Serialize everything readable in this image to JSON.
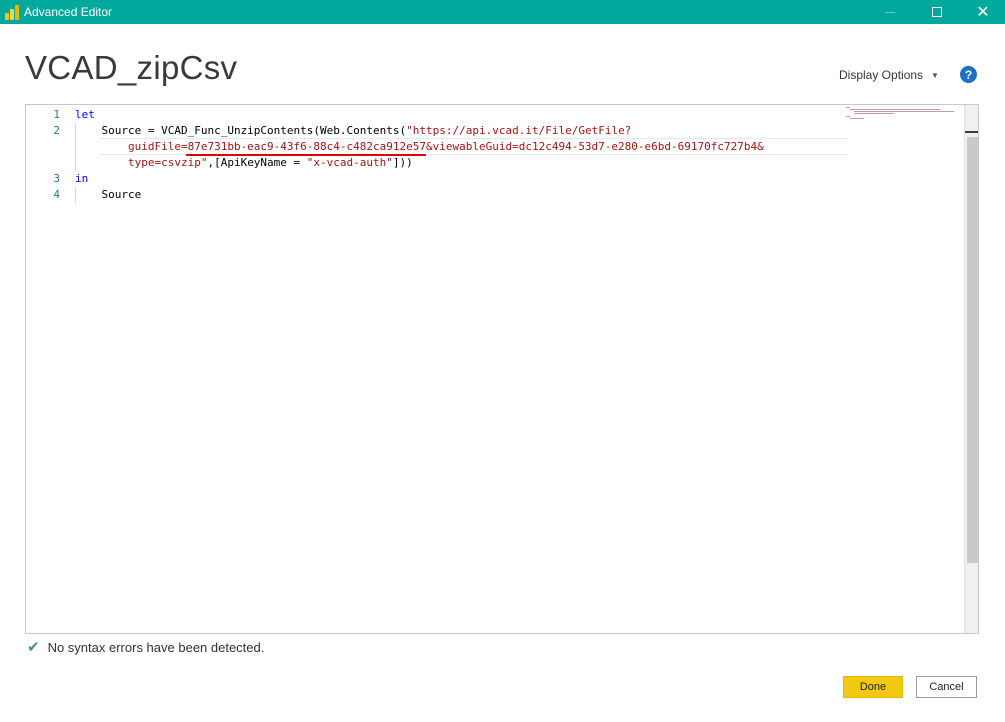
{
  "window": {
    "title": "Advanced Editor",
    "icon": "powerbi-icon",
    "colors": {
      "titlebar": "#01a99d",
      "accent_button": "#f2c811"
    }
  },
  "header": {
    "query_name": "VCAD_zipCsv",
    "display_options_label": "Display Options",
    "help_label": "?"
  },
  "editor": {
    "lines": [
      {
        "number": "1",
        "tokens": [
          {
            "t": "let",
            "c": "kw"
          }
        ]
      },
      {
        "number": "2",
        "tokens": [
          {
            "t": "    Source = VCAD_Func_UnzipContents(Web.Contents(",
            "c": ""
          },
          {
            "t": "\"https://api.vcad.it/File/GetFile?",
            "c": "str"
          }
        ]
      },
      {
        "number": "",
        "tokens": [
          {
            "t": "        guidFile=87e731bb-eac9-43f6-88c4-c482ca912e57&viewableGuid=dc12c494-53d7-e280-e6bd-69170fc727b4&",
            "c": "str"
          }
        ]
      },
      {
        "number": "",
        "tokens": [
          {
            "t": "        type=csvzip\"",
            "c": "str"
          },
          {
            "t": ",[ApiKeyName = ",
            "c": ""
          },
          {
            "t": "\"x-vcad-auth\"",
            "c": "str"
          },
          {
            "t": "]))",
            "c": ""
          }
        ]
      },
      {
        "number": "3",
        "tokens": [
          {
            "t": "in",
            "c": "kw"
          }
        ]
      },
      {
        "number": "4",
        "tokens": [
          {
            "t": "    Source",
            "c": ""
          }
        ]
      }
    ]
  },
  "status": {
    "icon": "check-icon",
    "message": "No syntax errors have been detected."
  },
  "buttons": {
    "done_label": "Done",
    "cancel_label": "Cancel"
  }
}
